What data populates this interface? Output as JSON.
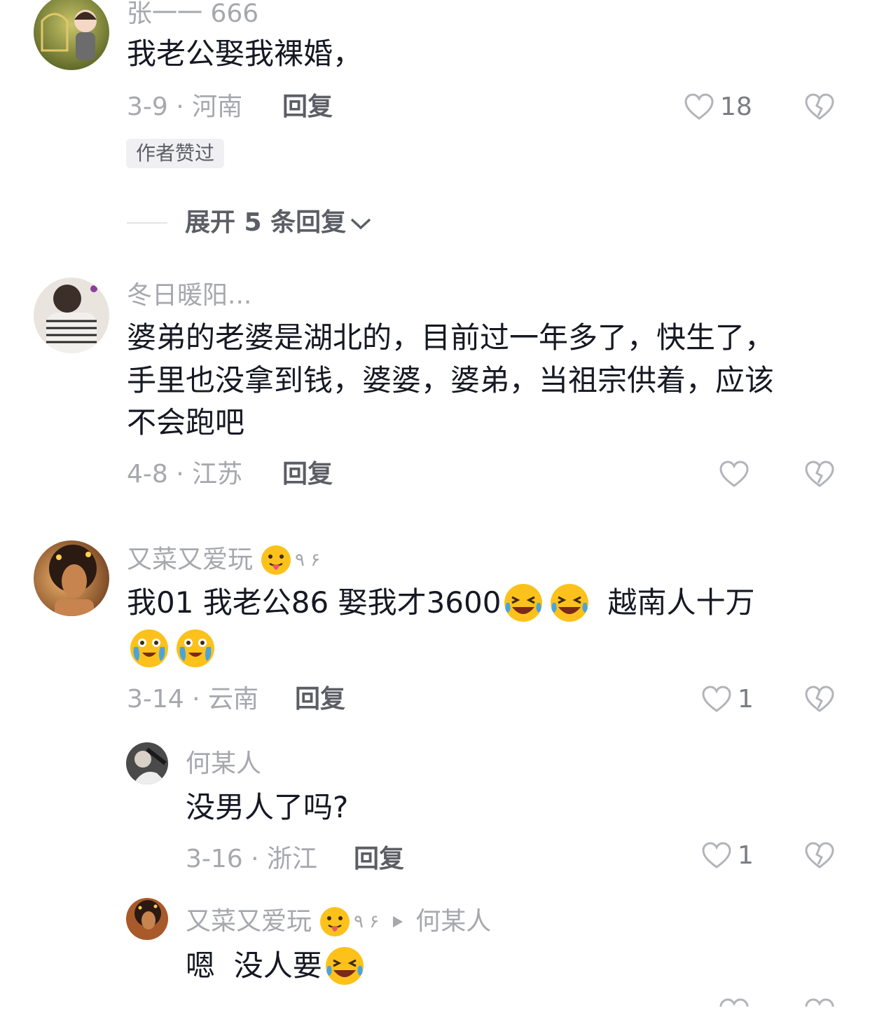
{
  "comments": [
    {
      "username": "张一一 666",
      "text": "我老公娶我裸婚，",
      "date_location": "3-9 · 河南",
      "reply_label": "回复",
      "likes": "18",
      "badge": "作者赞过",
      "expand_label": "展开 5 条回复"
    },
    {
      "username": "冬日暖阳...",
      "text_lines": [
        "婆弟的老婆是湖北的，目前过一年多了，快生了，",
        "手里也没拿到钱，婆婆，婆弟，当祖宗供着，应该",
        "不会跑吧"
      ],
      "date_location": "4-8 · 江苏",
      "reply_label": "回复",
      "likes": ""
    },
    {
      "username": "又菜又爱玩",
      "username_suffix": "٩ ۶",
      "text_part1": "我01 我老公86   娶我才3600",
      "text_part2": "越南人十万",
      "date_location": "3-14 · 云南",
      "reply_label": "回复",
      "likes": "1",
      "replies": [
        {
          "username": "何某人",
          "text": "没男人了吗?",
          "date_location": "3-16 · 浙江",
          "reply_label": "回复",
          "likes": "1"
        },
        {
          "username": "又菜又爱玩",
          "username_suffix": "٩ ۶",
          "reply_to": "何某人",
          "text": "嗯  没人要"
        }
      ]
    }
  ],
  "icons": {
    "like": "heart-outline-icon",
    "dislike": "broken-heart-icon",
    "expand": "chevron-down-icon",
    "reply_arrow": "triangle-right-icon"
  },
  "colors": {
    "text": "#161823",
    "muted": "#a6a8ad",
    "action": "#5c5e66",
    "badge_bg": "#f0f0f2"
  }
}
